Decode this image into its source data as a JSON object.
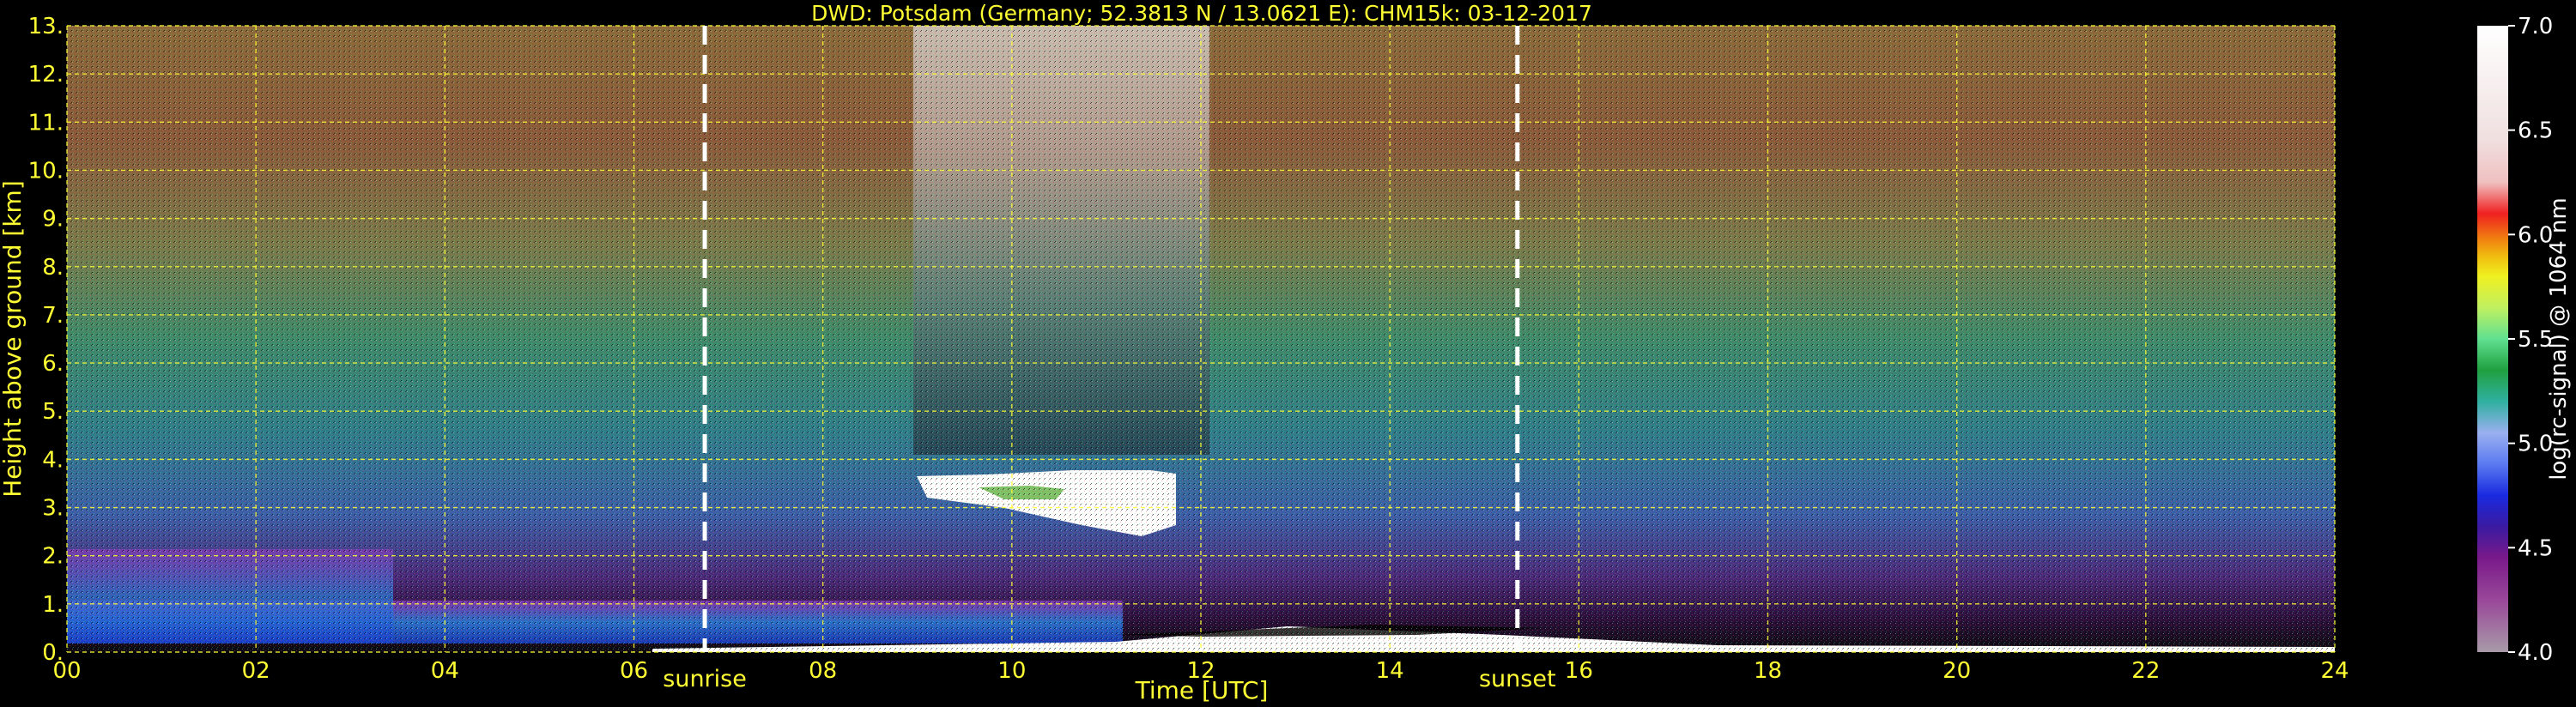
{
  "chart_data": {
    "type": "heatmap",
    "title": "DWD: Potsdam (Germany; 52.3813 N / 13.0621 E):    CHM15k: 03-12-2017",
    "xlabel": "Time [UTC]",
    "ylabel": "Height above ground [km]",
    "xlim": [
      0,
      24
    ],
    "ylim": [
      0,
      13
    ],
    "x_ticks": [
      "00",
      "02",
      "04",
      "06",
      "08",
      "10",
      "12",
      "14",
      "16",
      "18",
      "20",
      "22",
      "24"
    ],
    "y_ticks": [
      "0.",
      "1.",
      "2.",
      "3.",
      "4.",
      "5.",
      "6.",
      "7.",
      "8.",
      "9.",
      "10.",
      "11.",
      "12.",
      "13."
    ],
    "grid": true,
    "colorbar": {
      "label": "log(rc-signal) @ 1064 nm",
      "range": [
        4.0,
        7.0
      ],
      "ticks": [
        "4.0",
        "4.5",
        "5.0",
        "5.5",
        "6.0",
        "6.5",
        "7.0"
      ]
    },
    "events": [
      {
        "name": "sunrise",
        "time_utc": 6.75
      },
      {
        "name": "sunset",
        "time_utc": 15.35
      }
    ],
    "features": [
      {
        "description": "cloud layer",
        "x_start": 9.0,
        "x_end": 11.7,
        "y_bottom": 2.3,
        "y_top": 3.7
      },
      {
        "description": "boundary layer aerosol",
        "x_start": 0.0,
        "x_end": 24.0,
        "y_bottom": 0.0,
        "y_top": 1.0
      }
    ]
  },
  "colors": {
    "background": "#000000",
    "text": "#ffff33",
    "grid": "#ffff33",
    "event_line": "#ffffff",
    "cbar_text": "#ffffff"
  }
}
